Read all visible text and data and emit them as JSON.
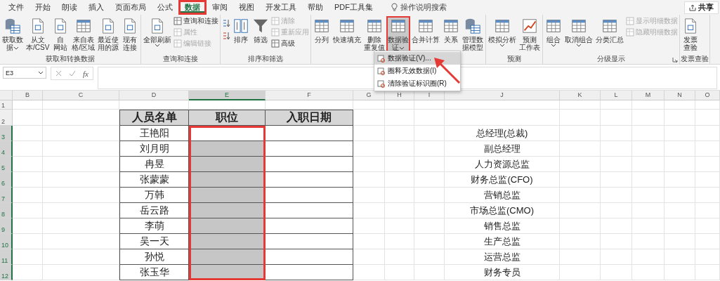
{
  "tabs": [
    {
      "label": "文件",
      "selected": false,
      "callout": false
    },
    {
      "label": "开始",
      "selected": false,
      "callout": false
    },
    {
      "label": "朗读",
      "selected": false,
      "callout": false
    },
    {
      "label": "插入",
      "selected": false,
      "callout": false
    },
    {
      "label": "页面布局",
      "selected": false,
      "callout": false
    },
    {
      "label": "公式",
      "selected": false,
      "callout": false
    },
    {
      "label": "数据",
      "selected": true,
      "callout": true
    },
    {
      "label": "审阅",
      "selected": false,
      "callout": false
    },
    {
      "label": "视图",
      "selected": false,
      "callout": false
    },
    {
      "label": "开发工具",
      "selected": false,
      "callout": false
    },
    {
      "label": "帮助",
      "selected": false,
      "callout": false
    },
    {
      "label": "PDF工具集",
      "selected": false,
      "callout": false
    }
  ],
  "tell_me": "操作说明搜索",
  "share_button": "共享",
  "ribbon_groups": [
    {
      "label": "获取和转换数据",
      "items": [
        {
          "kind": "large",
          "lines": [
            "获取数",
            "据"
          ],
          "dropdown": true,
          "pressed": false,
          "callout": false
        },
        {
          "kind": "large",
          "lines": [
            "从文",
            "本/CSV"
          ],
          "dropdown": false,
          "pressed": false,
          "callout": false
        },
        {
          "kind": "large",
          "lines": [
            "自",
            "网站"
          ],
          "dropdown": false,
          "pressed": false,
          "callout": false
        },
        {
          "kind": "large",
          "lines": [
            "来自表",
            "格/区域"
          ],
          "dropdown": false,
          "pressed": false,
          "callout": false
        },
        {
          "kind": "large",
          "lines": [
            "最近使",
            "用的源"
          ],
          "dropdown": false,
          "pressed": false,
          "callout": false
        },
        {
          "kind": "large",
          "lines": [
            "现有",
            "连接"
          ],
          "dropdown": false,
          "pressed": false,
          "callout": false
        }
      ]
    },
    {
      "label": "查询和连接",
      "items": [
        {
          "kind": "large",
          "lines": [
            "全部刷新"
          ],
          "dropdown": true,
          "pressed": false,
          "callout": false
        },
        {
          "kind": "stack",
          "items": [
            {
              "label": "查询和连接",
              "disabled": false
            },
            {
              "label": "属性",
              "disabled": true
            },
            {
              "label": "编辑链接",
              "disabled": true
            }
          ]
        }
      ]
    },
    {
      "label": "排序和筛选",
      "items": [
        {
          "kind": "sort_pair"
        },
        {
          "kind": "large",
          "lines": [
            "排序"
          ],
          "dropdown": false,
          "pressed": false,
          "callout": false
        },
        {
          "kind": "large",
          "lines": [
            "筛选"
          ],
          "dropdown": false,
          "pressed": false,
          "callout": false
        },
        {
          "kind": "stack",
          "items": [
            {
              "label": "清除",
              "disabled": true
            },
            {
              "label": "重新应用",
              "disabled": true
            },
            {
              "label": "高级",
              "disabled": false
            }
          ]
        }
      ]
    },
    {
      "items": [
        {
          "kind": "large",
          "lines": [
            "分列"
          ],
          "dropdown": false,
          "pressed": false,
          "callout": false
        },
        {
          "kind": "large",
          "lines": [
            "快速填充"
          ],
          "dropdown": false,
          "pressed": false,
          "callout": false
        },
        {
          "kind": "large",
          "lines": [
            "删除",
            "重复值"
          ],
          "dropdown": false,
          "pressed": false,
          "callout": false
        },
        {
          "kind": "large",
          "lines": [
            "数据验",
            "证"
          ],
          "dropdown": true,
          "pressed": true,
          "callout": true
        },
        {
          "kind": "large",
          "lines": [
            "合并计算"
          ],
          "dropdown": false,
          "pressed": false,
          "callout": false
        },
        {
          "kind": "large",
          "lines": [
            "关系"
          ],
          "dropdown": false,
          "pressed": false,
          "callout": false
        },
        {
          "kind": "large",
          "lines": [
            "管理数",
            "据模型"
          ],
          "dropdown": false,
          "pressed": false,
          "callout": false
        }
      ]
    },
    {
      "label": "预测",
      "items": [
        {
          "kind": "large",
          "lines": [
            "模拟分析"
          ],
          "dropdown": true,
          "pressed": false,
          "callout": false
        },
        {
          "kind": "large",
          "lines": [
            "预测",
            "工作表"
          ],
          "dropdown": false,
          "pressed": false,
          "callout": false
        }
      ]
    },
    {
      "label": "分级显示",
      "launcher": true,
      "items": [
        {
          "kind": "large",
          "lines": [
            "组合"
          ],
          "dropdown": true,
          "pressed": false,
          "callout": false
        },
        {
          "kind": "large",
          "lines": [
            "取消组合"
          ],
          "dropdown": true,
          "pressed": false,
          "callout": false
        },
        {
          "kind": "large",
          "lines": [
            "分类汇总"
          ],
          "dropdown": false,
          "pressed": false,
          "callout": false
        },
        {
          "kind": "stack",
          "items": [
            {
              "label": "显示明细数据",
              "disabled": true
            },
            {
              "label": "隐藏明细数据",
              "disabled": true
            }
          ]
        }
      ]
    },
    {
      "label": "发票查验",
      "items": [
        {
          "kind": "large",
          "lines": [
            "发票",
            "查验"
          ],
          "dropdown": false,
          "pressed": false,
          "callout": false
        }
      ]
    }
  ],
  "name_box": "E3",
  "function_label": "fx",
  "menu": [
    {
      "label": "数据验证(V)...",
      "selected": true
    },
    {
      "label": "圈释无效数据(I)",
      "selected": false
    },
    {
      "label": "清除验证标识圈(R)",
      "selected": false
    }
  ],
  "sheet": {
    "columns": [
      {
        "label": "B",
        "selected": false,
        "callout": false
      },
      {
        "label": "C",
        "selected": false,
        "callout": false
      },
      {
        "label": "D",
        "selected": false,
        "callout": false
      },
      {
        "label": "E",
        "selected": true,
        "callout": true
      },
      {
        "label": "F",
        "selected": false,
        "callout": false
      },
      {
        "label": "G",
        "selected": false,
        "callout": false
      },
      {
        "label": "H",
        "selected": false,
        "callout": false
      },
      {
        "label": "I",
        "selected": false,
        "callout": false
      },
      {
        "label": "J",
        "selected": false,
        "callout": false
      },
      {
        "label": "K",
        "selected": false,
        "callout": false
      },
      {
        "label": "L",
        "selected": false,
        "callout": false
      },
      {
        "label": "M",
        "selected": false,
        "callout": false
      },
      {
        "label": "N",
        "selected": false,
        "callout": false
      },
      {
        "label": "O",
        "selected": false,
        "callout": false
      }
    ],
    "rows": [
      {
        "label": "1",
        "selected": false
      },
      {
        "label": "2",
        "selected": false
      },
      {
        "label": "3",
        "selected": true
      },
      {
        "label": "4",
        "selected": true
      },
      {
        "label": "5",
        "selected": true
      },
      {
        "label": "6",
        "selected": true
      },
      {
        "label": "7",
        "selected": true
      },
      {
        "label": "8",
        "selected": true
      },
      {
        "label": "9",
        "selected": true
      },
      {
        "label": "10",
        "selected": true
      },
      {
        "label": "11",
        "selected": true
      },
      {
        "label": "12",
        "selected": true
      }
    ],
    "table_headers": [
      "人员名单",
      "职位",
      "入职日期"
    ],
    "names": [
      "王艳阳",
      "刘月明",
      "冉昱",
      "张蒙蒙",
      "万韩",
      "岳云路",
      "李萌",
      "吴一天",
      "孙悦",
      "张玉华"
    ],
    "positions": [
      "总经理(总裁)",
      "副总经理",
      "人力资源总监",
      "财务总监(CFO)",
      "营销总监",
      "市场总监(CMO)",
      "销售总监",
      "生产总监",
      "运营总监",
      "财务专员"
    ]
  }
}
